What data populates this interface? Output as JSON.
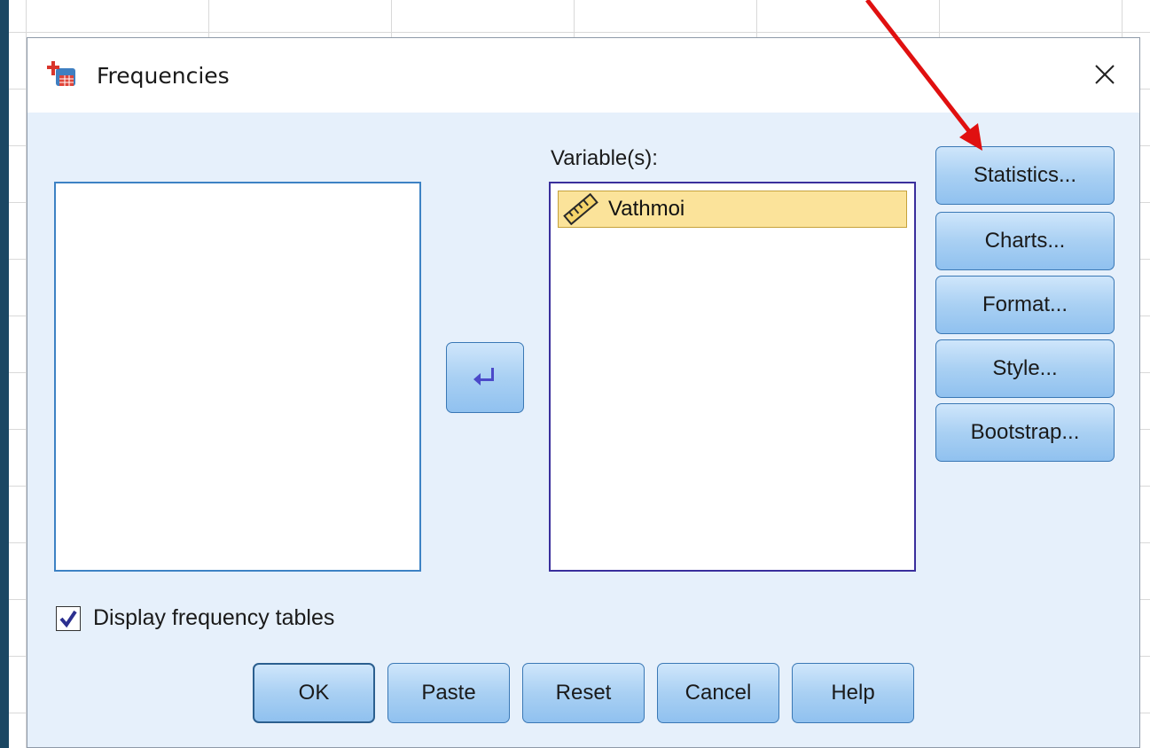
{
  "window": {
    "title": "Frequencies"
  },
  "target_list": {
    "label": "Variable(s):",
    "items": [
      {
        "name": "Vathmoi",
        "icon": "ruler-scale-icon",
        "selected": true
      }
    ]
  },
  "side_buttons": {
    "statistics": "Statistics...",
    "charts": "Charts...",
    "format": "Format...",
    "style": "Style...",
    "bootstrap": "Bootstrap..."
  },
  "options": {
    "display_frequency_tables": {
      "label": "Display frequency tables",
      "checked": true
    }
  },
  "bottom_buttons": {
    "ok": "OK",
    "paste": "Paste",
    "reset": "Reset",
    "cancel": "Cancel",
    "help": "Help"
  },
  "colors": {
    "dialog_background": "#e6f0fb",
    "button_gradient_top": "#cfe6fb",
    "button_gradient_bottom": "#90c1ef",
    "selected_item": "#fbe39a",
    "annotation_arrow": "#e01010"
  }
}
